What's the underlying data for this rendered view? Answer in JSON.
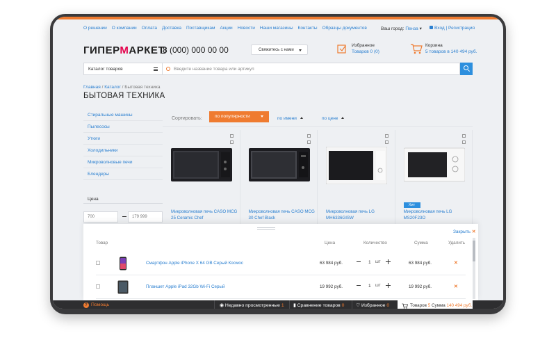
{
  "topnav": {
    "links": [
      "О решении",
      "О компании",
      "Оплата",
      "Доставка",
      "Поставщикам",
      "Акции",
      "Новости",
      "Наши магазины",
      "Контакты",
      "Образцы документов"
    ],
    "city_label": "Ваш город:",
    "city_value": "Пенза",
    "login": "Вход",
    "register": "Регистрация"
  },
  "header": {
    "logo_pre": "ГИПЕР",
    "logo_m": "М",
    "logo_post": "АРКЕТ",
    "phone": "8 (000) 000 00 00",
    "contact_button": "Свяжитесь с нами",
    "favorites_title": "Избранное",
    "favorites_sub": "Товаров 0 (0)",
    "cart_title": "Корзина",
    "cart_sub": "5 товаров в 140 494 руб."
  },
  "search": {
    "catalog_button": "Каталог товаров",
    "placeholder": "Введите название товара или артикул"
  },
  "breadcrumb": {
    "home": "Главная",
    "sep": "/",
    "catalog": "Каталог",
    "current": "Бытовая техника"
  },
  "page_title": "БЫТОВАЯ ТЕХНИКА",
  "sidebar": {
    "items": [
      "Стиральные машины",
      "Пылесосы",
      "Утюги",
      "Холодильники",
      "Микроволновые печи",
      "Блендеры"
    ],
    "price_label": "Цена",
    "price_from": "700",
    "price_to": "179 999"
  },
  "sort": {
    "label": "Сортировать:",
    "active": "по популярности",
    "by_name": "по имени",
    "by_price": "по цене"
  },
  "products": [
    {
      "name": "Микроволновая печь CASO MCG 25 Ceramic Chef",
      "hit": ""
    },
    {
      "name": "Микроволновая печь CASO MCG 30 Chef Black",
      "hit": ""
    },
    {
      "name": "Микроволновая печь LG MH6336GISW",
      "hit": ""
    },
    {
      "name": "Микроволновая печь LG MS20F23O",
      "hit": "Хит"
    }
  ],
  "cart_panel": {
    "close_label": "Закрыть",
    "headers": {
      "product": "Товар",
      "price": "Цена",
      "qty": "Количество",
      "sum": "Сумма",
      "delete": "Удалить"
    },
    "rows": [
      {
        "name": "Смартфон Apple iPhone X 64 GB Серый Космос",
        "price": "63 984 руб.",
        "qty": "1",
        "unit": "шт",
        "sum": "63 984 руб."
      },
      {
        "name": "Планшет Apple iPad 32Gb Wi-Fi Серый",
        "price": "19 992 руб.",
        "qty": "1",
        "unit": "шт",
        "sum": "19 992 руб."
      }
    ]
  },
  "bottombar": {
    "help": "Помощь",
    "recent": "Недавно просмотренные",
    "recent_count": "1",
    "compare": "Сравнение товаров",
    "compare_count": "0",
    "favorites": "Избранное",
    "favorites_count": "0",
    "cart_items": "Товаров",
    "cart_count": "5",
    "cart_sum_label": "Сумма",
    "cart_sum": "140 494 руб."
  },
  "colors": {
    "accent": "#ef7b30",
    "link": "#2a7fd0",
    "brand_m": "#e4004b",
    "button_blue": "#2d8fde"
  }
}
